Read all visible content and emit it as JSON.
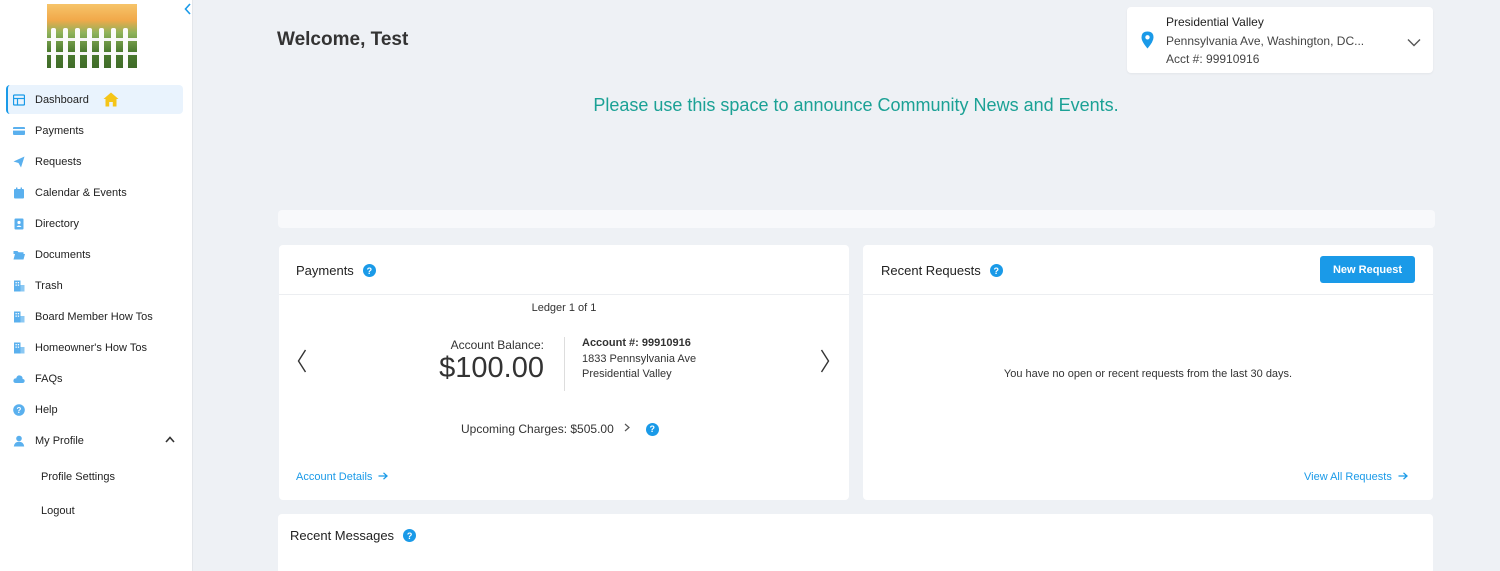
{
  "sidebar": {
    "collapse_icon": "chevron-left-icon",
    "items": [
      {
        "label": "Dashboard",
        "icon": "grid-icon",
        "active": true
      },
      {
        "label": "Payments",
        "icon": "credit-card-icon"
      },
      {
        "label": "Requests",
        "icon": "paper-plane-icon"
      },
      {
        "label": "Calendar & Events",
        "icon": "calendar-icon"
      },
      {
        "label": "Directory",
        "icon": "contact-book-icon"
      },
      {
        "label": "Documents",
        "icon": "folder-open-icon"
      },
      {
        "label": "Trash",
        "icon": "building-icon"
      },
      {
        "label": "Board Member How Tos",
        "icon": "building-icon"
      },
      {
        "label": "Homeowner's How Tos",
        "icon": "building-icon"
      },
      {
        "label": "FAQs",
        "icon": "cloud-icon"
      },
      {
        "label": "Help",
        "icon": "question-circle-icon"
      },
      {
        "label": "My Profile",
        "icon": "user-icon",
        "expanded": true
      }
    ],
    "profile_subitems": [
      {
        "label": "Profile Settings"
      },
      {
        "label": "Logout"
      }
    ]
  },
  "header": {
    "welcome": "Welcome, Test",
    "account_selector": {
      "community": "Presidential Valley",
      "address": "Pennsylvania Ave, Washington, DC...",
      "acct": "Acct #: 99910916"
    }
  },
  "announcement": "Please use this space to announce Community News and Events.",
  "payments": {
    "title": "Payments",
    "ledger": "Ledger 1 of 1",
    "balance_label": "Account Balance:",
    "balance_value": "$100.00",
    "account_number": "Account #: 99910916",
    "address_line1": "1833 Pennsylvania Ave",
    "address_line2": "Presidential Valley",
    "upcoming": "Upcoming Charges: $505.00",
    "details_link": "Account Details"
  },
  "requests": {
    "title": "Recent Requests",
    "new_button": "New Request",
    "empty_message": "You have no open or recent requests from the last 30 days.",
    "view_all": "View All Requests"
  },
  "messages": {
    "title": "Recent Messages"
  },
  "colors": {
    "accent": "#1a9ae8",
    "announcement": "#1ba195",
    "background": "#eef1f5",
    "home_badge": "#f5c518"
  }
}
